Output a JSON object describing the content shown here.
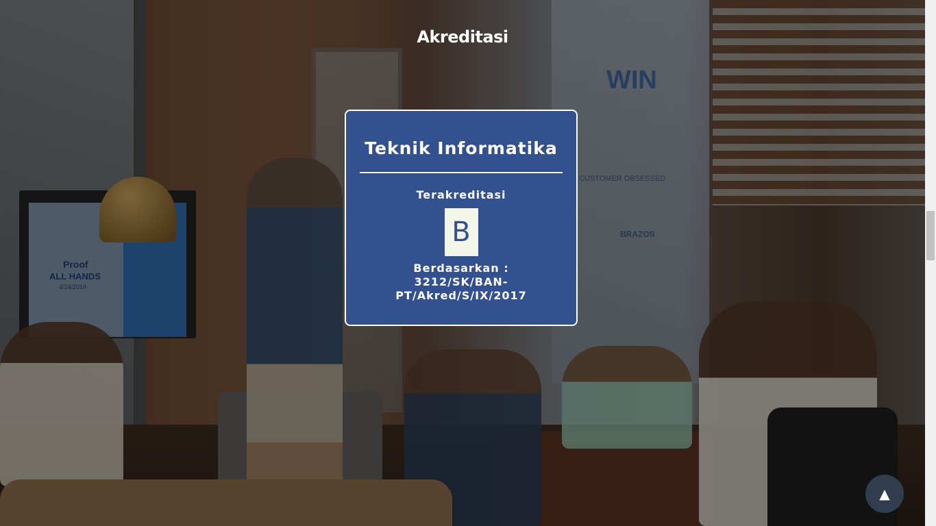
{
  "section": {
    "title": "Akreditasi"
  },
  "card": {
    "program": "Teknik Informatika",
    "status": "Terakreditasi",
    "grade": "B",
    "basis_line1": "Berdasarkan :",
    "basis_line2": "3212/SK/BAN-",
    "basis_line3": "PT/Akred/S/IX/2017"
  },
  "background_photo_text": {
    "screen_line1": "Proof",
    "screen_line2": "ALL HANDS",
    "screen_line3": "4/24/2019",
    "wall_big": "WIN",
    "wall_tag1": "CUSTOMER OBSESSED",
    "wall_tag2": "BRAZOS"
  },
  "back_to_top": {
    "icon": "arrow-up-icon",
    "glyph": "▲"
  },
  "colors": {
    "card_bg": "#34518f",
    "grade_bg": "#f3f4ea",
    "button_bg": "#2f3d4f"
  }
}
